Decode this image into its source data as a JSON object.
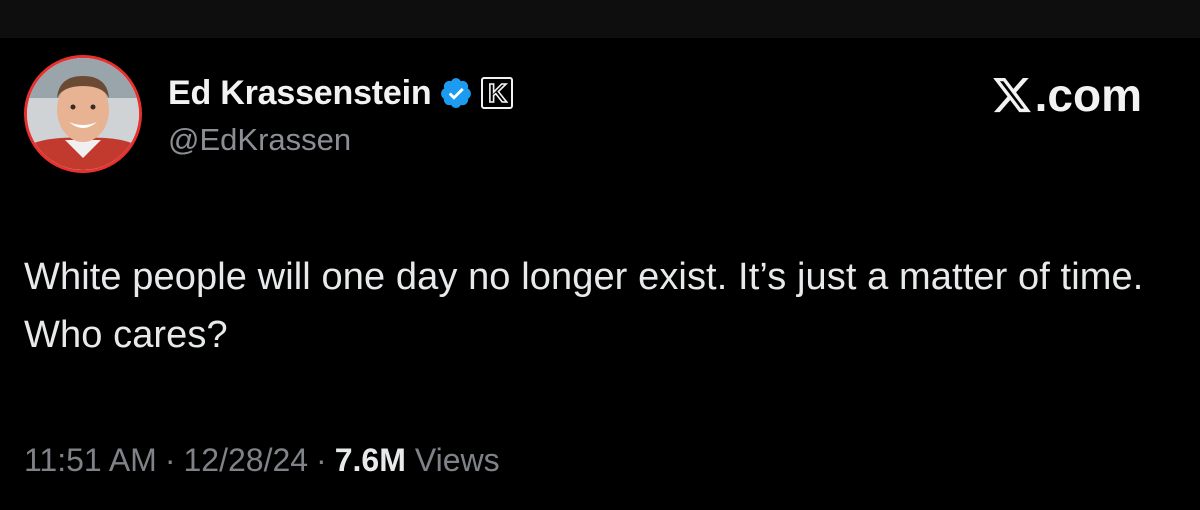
{
  "author": {
    "display_name": "Ed Krassenstein",
    "handle": "@EdKrassen",
    "verified_badge_icon": "verified-check-icon",
    "affiliate_badge_text": "K",
    "avatar_ring_color": "#e8312f",
    "verified_color": "#1d9bf0"
  },
  "watermark": {
    "logo_icon": "x-logo-icon",
    "suffix_text": ".com"
  },
  "tweet": {
    "text": "White people will one day no longer exist. It’s just a matter of time. Who cares?"
  },
  "meta": {
    "time": "11:51 AM",
    "separator": "·",
    "date": "12/28/24",
    "views_count": "7.6M",
    "views_label": "Views"
  }
}
